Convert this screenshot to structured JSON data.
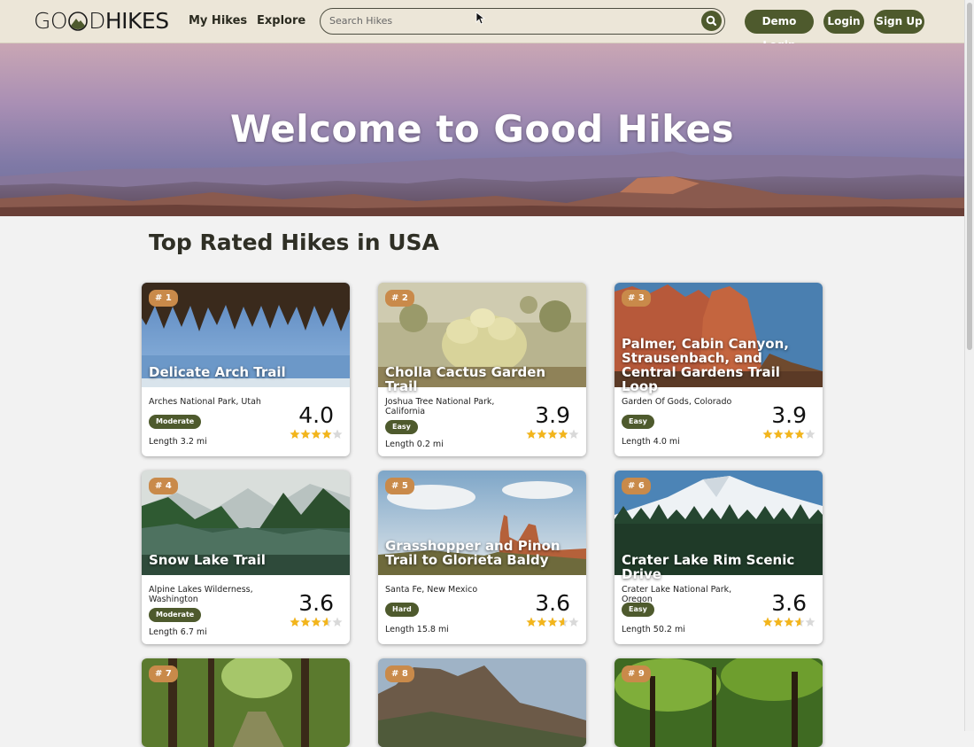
{
  "header": {
    "logo_text": "GOODHIKES",
    "nav": {
      "my_hikes": "My Hikes",
      "explore": "Explore"
    },
    "search": {
      "placeholder": "Search Hikes",
      "value": ""
    },
    "buttons": {
      "demo_login": "Demo Login",
      "login": "Login",
      "signup": "Sign Up"
    },
    "accent_color": "#4e5a2d"
  },
  "hero": {
    "title": "Welcome to Good Hikes"
  },
  "section": {
    "title": "Top Rated Hikes in USA"
  },
  "hikes": [
    {
      "rank": "# 1",
      "name": "Delicate Arch Trail",
      "location": "Arches National Park, Utah",
      "difficulty": "Moderate",
      "length": "Length 3.2 mi",
      "rating": "4.0",
      "stars": 4.0
    },
    {
      "rank": "# 2",
      "name": "Cholla Cactus Garden Trail",
      "location": "Joshua Tree National Park, California",
      "difficulty": "Easy",
      "length": "Length 0.2 mi",
      "rating": "3.9",
      "stars": 3.9
    },
    {
      "rank": "# 3",
      "name": "Palmer, Cabin Canyon, Strausenbach, and Central Gardens Trail Loop",
      "location": "Garden Of Gods, Colorado",
      "difficulty": "Easy",
      "length": "Length 4.0 mi",
      "rating": "3.9",
      "stars": 3.9
    },
    {
      "rank": "# 4",
      "name": "Snow Lake Trail",
      "location": "Alpine Lakes Wilderness, Washington",
      "difficulty": "Moderate",
      "length": "Length 6.7 mi",
      "rating": "3.6",
      "stars": 3.6
    },
    {
      "rank": "# 5",
      "name": "Grasshopper and Pinon Trail to Glorieta Baldy",
      "location": "Santa Fe, New Mexico",
      "difficulty": "Hard",
      "length": "Length 15.8 mi",
      "rating": "3.6",
      "stars": 3.6
    },
    {
      "rank": "# 6",
      "name": "Crater Lake Rim Scenic Drive",
      "location": "Crater Lake National Park, Oregon",
      "difficulty": "Easy",
      "length": "Length 50.2 mi",
      "rating": "3.6",
      "stars": 3.6
    },
    {
      "rank": "# 7"
    },
    {
      "rank": "# 8"
    },
    {
      "rank": "# 9"
    }
  ],
  "colors": {
    "rank_badge": "#c98a4a",
    "star_fill": "#f3b51b",
    "star_empty": "#d9d9d9"
  }
}
